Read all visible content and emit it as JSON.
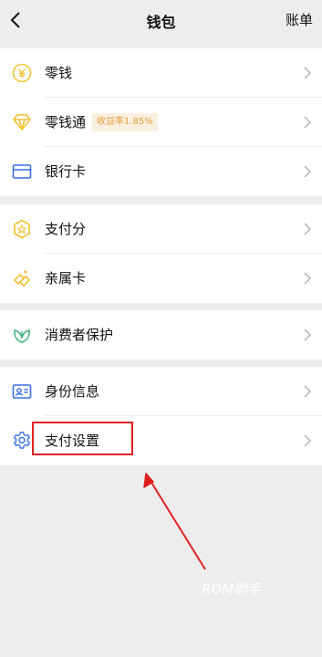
{
  "header": {
    "title": "钱包",
    "bill_label": "账单"
  },
  "groups": [
    {
      "items": [
        {
          "label": "零钱",
          "icon": "yen-coin-icon"
        },
        {
          "label": "零钱通",
          "icon": "diamond-icon",
          "badge": "收益率1.85%"
        },
        {
          "label": "银行卡",
          "icon": "bank-card-icon"
        }
      ]
    },
    {
      "items": [
        {
          "label": "支付分",
          "icon": "score-shield-icon"
        },
        {
          "label": "亲属卡",
          "icon": "family-card-icon"
        }
      ]
    },
    {
      "items": [
        {
          "label": "消费者保护",
          "icon": "leaf-shield-icon"
        }
      ]
    },
    {
      "items": [
        {
          "label": "身份信息",
          "icon": "id-card-icon"
        },
        {
          "label": "支付设置",
          "icon": "gear-icon"
        }
      ]
    }
  ],
  "watermark": "ROM助手",
  "colors": {
    "accent_yellow": "#f1c232",
    "accent_green": "#3fb27f",
    "accent_blue": "#3a6ee8",
    "annotation_red": "#e02020"
  }
}
